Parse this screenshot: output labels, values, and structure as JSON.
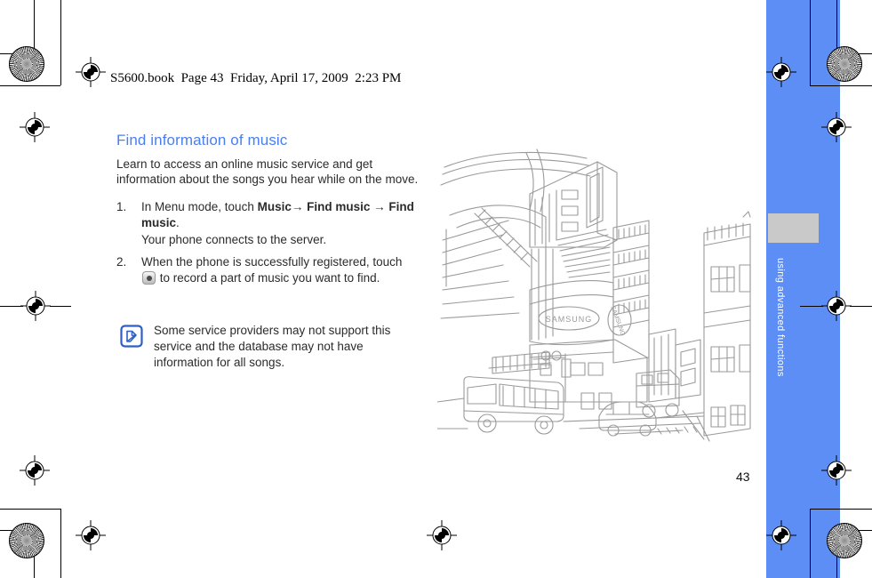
{
  "print": {
    "file_header": "S5600.book  Page 43  Friday, April 17, 2009  2:23 PM",
    "registration_marks": [
      "crosshair-target",
      "starburst-density-patch"
    ]
  },
  "sidebar": {
    "label": "using advanced functions",
    "band_color": "#5c8ef5",
    "tab_color": "#c9c9c9"
  },
  "page": {
    "number": "43",
    "heading": "Find information of music",
    "heading_color": "#4a7fef",
    "intro": "Learn to access an online music service and get information about the songs you hear while on the move.",
    "steps": [
      {
        "number": "1.",
        "text_before": "In Menu mode, touch ",
        "menu_1": "Music",
        "arrow_1": "→",
        "menu_2": "Find music",
        "arrow_2": "→",
        "menu_3": "Find music",
        "text_after": ".",
        "sub": "Your phone connects to the server."
      },
      {
        "number": "2.",
        "text_before": "When the phone is successfully registered, touch ",
        "icon": "record-button-icon",
        "text_after": " to record a part of music you want to find."
      }
    ],
    "note": {
      "icon": "note-pen-icon",
      "text": "Some service providers may not support this service and the database may not have information for all songs."
    }
  },
  "illustration": {
    "name": "city-street-line-art",
    "description": "Gray line drawing of a city street corner with multi-storey buildings, a bus, a car and storefront signs",
    "sign_text": "SAMSUNG",
    "line_color": "#9a9a9a"
  }
}
